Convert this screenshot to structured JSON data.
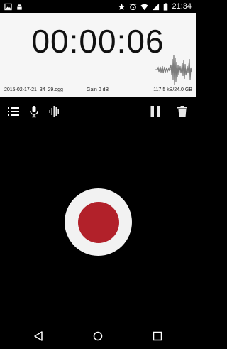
{
  "status_bar": {
    "time": "21:34",
    "left_icons": [
      "gallery-icon",
      "android-debug-icon"
    ],
    "right_icons": [
      "star-icon",
      "alarm-icon",
      "wifi-icon",
      "signal-icon",
      "battery-icon"
    ]
  },
  "recorder": {
    "timer": "00:00:06",
    "filename": "2015-02-17-21_34_29.ogg",
    "gain": "Gain 0 dB",
    "size": "117.5 kB/24.0 GB"
  },
  "toolbar": {
    "left_icons": [
      "list-icon",
      "microphone-icon",
      "waveform-icon"
    ],
    "right_icons": [
      "pause-icon",
      "trash-icon"
    ]
  },
  "colors": {
    "record_red": "#b2212a",
    "panel_bg": "#f6f6f6",
    "background": "#000000"
  },
  "nav_bar": {
    "icons": [
      "back-icon",
      "home-icon",
      "recents-icon"
    ]
  }
}
